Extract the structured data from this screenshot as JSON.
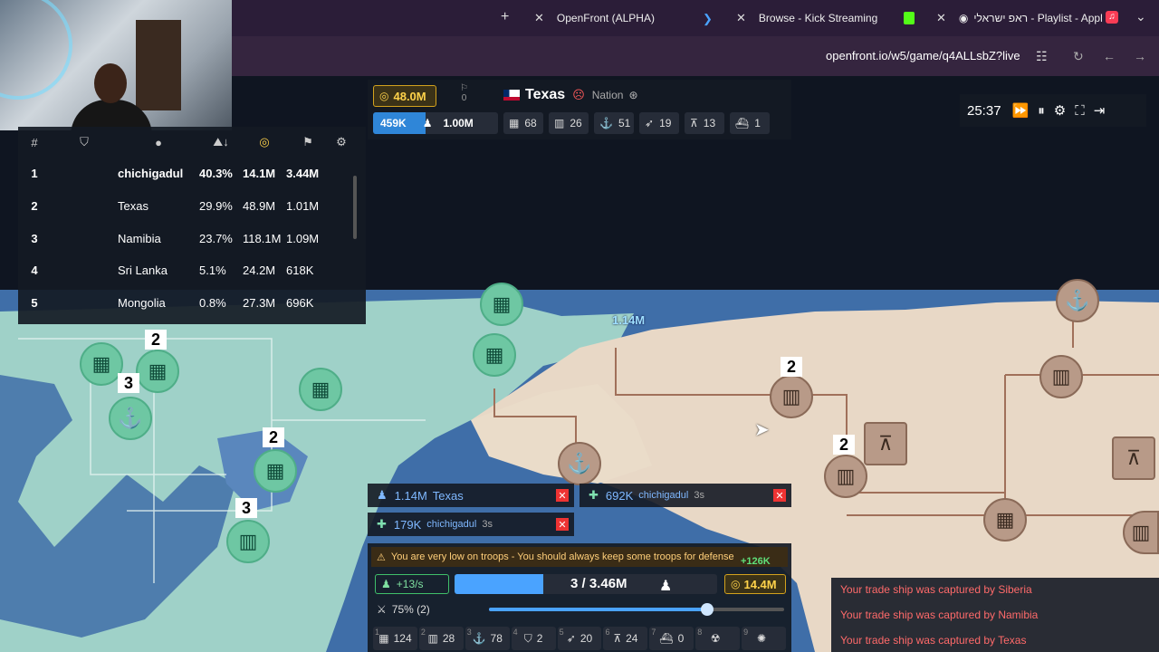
{
  "browser": {
    "tabs": [
      {
        "label": "OpenFront (ALPHA)",
        "favicon_color": "#4aa3ff"
      },
      {
        "label": "Browse - Kick Streaming",
        "favicon_color": "#53fc18"
      },
      {
        "label": "ראפ ישראלי - Playlist - Appl",
        "favicon_color": "#fa3c55"
      }
    ],
    "new_tab_symbol": "+",
    "url": "openfront.io/w5/game/q4ALLsbZ?live"
  },
  "leaderboard": {
    "headers": [
      "#",
      "",
      "",
      "",
      "",
      "",
      ""
    ],
    "rows": [
      {
        "rank": "1",
        "name": "chichigadul",
        "territory": "40.3%",
        "gold": "14.1M",
        "troops": "3.44M"
      },
      {
        "rank": "2",
        "name": "Texas",
        "territory": "29.9%",
        "gold": "48.9M",
        "troops": "1.01M"
      },
      {
        "rank": "3",
        "name": "Namibia",
        "territory": "23.7%",
        "gold": "118.1M",
        "troops": "1.09M"
      },
      {
        "rank": "4",
        "name": "Sri Lanka",
        "territory": "5.1%",
        "gold": "24.2M",
        "troops": "618K"
      },
      {
        "rank": "5",
        "name": "Mongolia",
        "territory": "0.8%",
        "gold": "27.3M",
        "troops": "696K"
      }
    ]
  },
  "player_info": {
    "gold": "48.0M",
    "alliance_count": "0",
    "name": "Texas",
    "type": "Nation",
    "troops": "459K",
    "max_troops": "1.00M",
    "cities": "68",
    "factories": "26",
    "ports": "51",
    "missile_silos": "19",
    "sam_launchers": "13",
    "warships": "1"
  },
  "timer": {
    "time": "25:37"
  },
  "map_labels": {
    "troop_label": "1.14M"
  },
  "events": [
    {
      "troops": "1.14M",
      "player": "Texas"
    },
    {
      "troops": "692K",
      "player": "chichigadul",
      "time": "3s"
    },
    {
      "troops": "179K",
      "player": "chichigadul",
      "time": "3s"
    }
  ],
  "control": {
    "warning": "You are very low on troops - You should always keep some troops for defense",
    "gold_gain": "+126K",
    "troop_rate": "+13/s",
    "troops": "3 / 3.46M",
    "gold": "14.4M",
    "attack_ratio": "75% (2)",
    "slider_fraction": 0.74,
    "buildings": [
      {
        "key": "1",
        "count": "124",
        "icon": "city-icon"
      },
      {
        "key": "2",
        "count": "28",
        "icon": "factory-icon"
      },
      {
        "key": "3",
        "count": "78",
        "icon": "port-icon"
      },
      {
        "key": "4",
        "count": "2",
        "icon": "defense-post-icon"
      },
      {
        "key": "5",
        "count": "20",
        "icon": "missile-silo-icon"
      },
      {
        "key": "6",
        "count": "24",
        "icon": "sam-launcher-icon"
      },
      {
        "key": "7",
        "count": "0",
        "icon": "warship-icon"
      },
      {
        "key": "8",
        "count": "",
        "icon": "nuke-icon"
      },
      {
        "key": "9",
        "count": "",
        "icon": "hydrogen-bomb-icon"
      }
    ]
  },
  "messages": [
    "Your trade ship was captured by Siberia",
    "Your trade ship was captured by Namibia",
    "Your trade ship was captured by Texas"
  ],
  "colors": {
    "ocean": "#3f6ea8",
    "player_land": "#9fd1c8",
    "enemy_land": "#e8d8c6",
    "gold_accent": "#ffd24a",
    "troop_blue": "#4aa3ff"
  }
}
